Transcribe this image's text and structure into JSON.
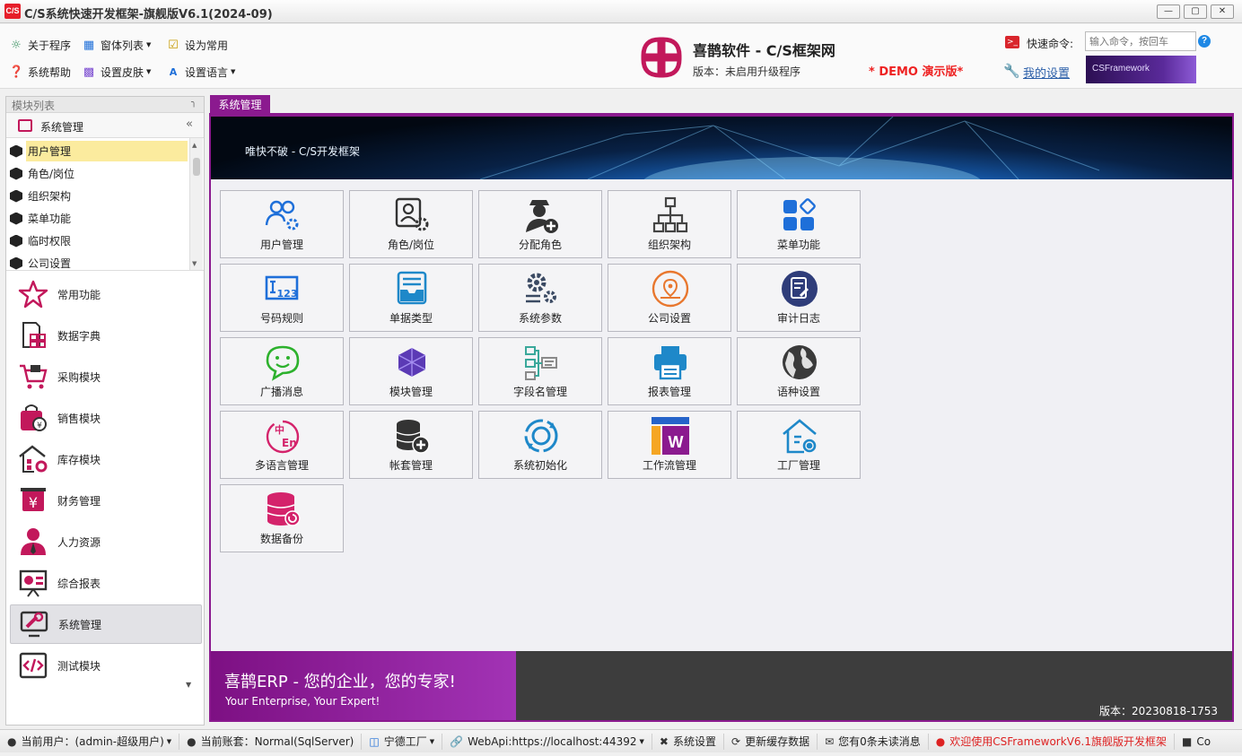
{
  "window": {
    "title": "C/S系统快速开发框架-旗舰版V6.1(2024-09)",
    "logo_text": "C/S"
  },
  "toolbar": {
    "about": "关于程序",
    "form_list": "窗体列表",
    "set_common": "设为常用",
    "help": "系统帮助",
    "skin": "设置皮肤",
    "language": "设置语言"
  },
  "brand": {
    "title": "喜鹊软件 - C/S框架网",
    "version": "版本：未启用升级程序",
    "demo": "* DEMO 演示版*"
  },
  "command": {
    "label": "快速命令:",
    "placeholder": "输入命令，按回车",
    "help": "?",
    "my_settings": "我的设置",
    "banner_text": "CSFramework"
  },
  "sidebar": {
    "header": "模块列表",
    "group": "系统管理",
    "items": [
      {
        "label": "用户管理",
        "selected": true
      },
      {
        "label": "角色/岗位"
      },
      {
        "label": "组织架构"
      },
      {
        "label": "菜单功能"
      },
      {
        "label": "临时权限"
      },
      {
        "label": "公司设置"
      }
    ],
    "modules": [
      {
        "label": "常用功能",
        "icon": "star-icon"
      },
      {
        "label": "数据字典",
        "icon": "dictionary-icon"
      },
      {
        "label": "采购模块",
        "icon": "cart-icon"
      },
      {
        "label": "销售模块",
        "icon": "sales-bag-icon"
      },
      {
        "label": "库存模块",
        "icon": "warehouse-icon"
      },
      {
        "label": "财务管理",
        "icon": "yuan-icon"
      },
      {
        "label": "人力资源",
        "icon": "person-icon"
      },
      {
        "label": "综合报表",
        "icon": "report-icon"
      },
      {
        "label": "系统管理",
        "icon": "system-tools-icon",
        "active": true
      },
      {
        "label": "测试模块",
        "icon": "code-icon"
      }
    ]
  },
  "tab": {
    "label": "系统管理"
  },
  "banner": {
    "text": "唯快不破 - C/S开发框架"
  },
  "tiles": [
    {
      "label": "用户管理",
      "icon": "users-gear-icon"
    },
    {
      "label": "角色/岗位",
      "icon": "role-card-icon"
    },
    {
      "label": "分配角色",
      "icon": "assign-role-icon"
    },
    {
      "label": "组织架构",
      "icon": "org-chart-icon"
    },
    {
      "label": "菜单功能",
      "icon": "menu-blocks-icon"
    },
    {
      "label": "号码规则",
      "icon": "number-rule-icon"
    },
    {
      "label": "单据类型",
      "icon": "document-type-icon"
    },
    {
      "label": "系统参数",
      "icon": "system-params-icon"
    },
    {
      "label": "公司设置",
      "icon": "company-location-icon"
    },
    {
      "label": "审计日志",
      "icon": "audit-log-icon"
    },
    {
      "label": "广播消息",
      "icon": "chat-bubble-icon"
    },
    {
      "label": "模块管理",
      "icon": "module-cubes-icon"
    },
    {
      "label": "字段名管理",
      "icon": "field-tree-icon"
    },
    {
      "label": "报表管理",
      "icon": "printer-icon"
    },
    {
      "label": "语种设置",
      "icon": "globe-icon"
    },
    {
      "label": "多语言管理",
      "icon": "multilang-icon"
    },
    {
      "label": "帐套管理",
      "icon": "database-add-icon"
    },
    {
      "label": "系统初始化",
      "icon": "refresh-ring-icon"
    },
    {
      "label": "工作流管理",
      "icon": "workflow-w-icon"
    },
    {
      "label": "工厂管理",
      "icon": "factory-home-icon"
    },
    {
      "label": "数据备份",
      "icon": "database-backup-icon"
    }
  ],
  "footer": {
    "title": "喜鹊ERP - 您的企业，您的专家!",
    "subtitle": "Your Enterprise, Your Expert!",
    "version": "版本：20230818-1753"
  },
  "status": {
    "user": "当前用户：(admin-超级用户)",
    "account": "当前账套：Normal(SqlServer)",
    "factory": "宁德工厂",
    "webapi": "WebApi:https://localhost:44392",
    "settings": "系统设置",
    "refresh": "更新缓存数据",
    "messages": "您有0条未读消息",
    "welcome": "欢迎使用CSFrameworkV6.1旗舰版开发框架",
    "trailing": "Co"
  },
  "colors": {
    "accent": "#8b1a8f",
    "icon_blue": "#1e6fd9",
    "icon_magenta": "#c2185b",
    "demo_red": "#e22222"
  }
}
